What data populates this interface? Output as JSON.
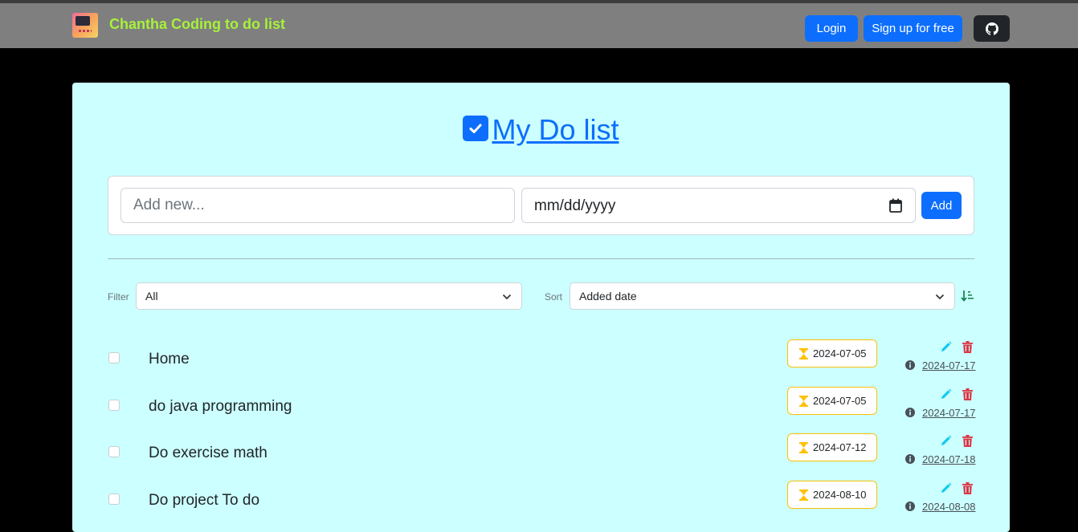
{
  "navbar": {
    "title": "Chantha Coding to do list",
    "login_label": "Login",
    "signup_label": "Sign up for free",
    "github_icon": "github-icon"
  },
  "main": {
    "title": "My Do list",
    "title_icon": "check-square-icon"
  },
  "add_form": {
    "task_placeholder": "Add new...",
    "date_placeholder": "mm/dd/yyyy",
    "add_label": "Add"
  },
  "controls": {
    "filter_label": "Filter",
    "filter_value": "All",
    "sort_label": "Sort",
    "sort_value": "Added date",
    "sort_direction_icon": "sort-ascending-icon"
  },
  "todos": [
    {
      "title": "Home",
      "due": "2024-07-05",
      "created": "2024-07-17",
      "done": false
    },
    {
      "title": "do java programming",
      "due": "2024-07-05",
      "created": "2024-07-17",
      "done": false
    },
    {
      "title": "Do exercise math",
      "due": "2024-07-12",
      "created": "2024-07-18",
      "done": false
    },
    {
      "title": "Do project To do",
      "due": "2024-08-10",
      "created": "2024-08-08",
      "done": false
    }
  ],
  "colors": {
    "navbar_bg": "#7f7f7f",
    "brand_title": "#a6f23a",
    "primary": "#0d6efd",
    "card_bg": "#ccffff",
    "badge_border": "#ffc107",
    "edit_icon": "#0dcaf0",
    "delete_icon": "#dc3545"
  }
}
